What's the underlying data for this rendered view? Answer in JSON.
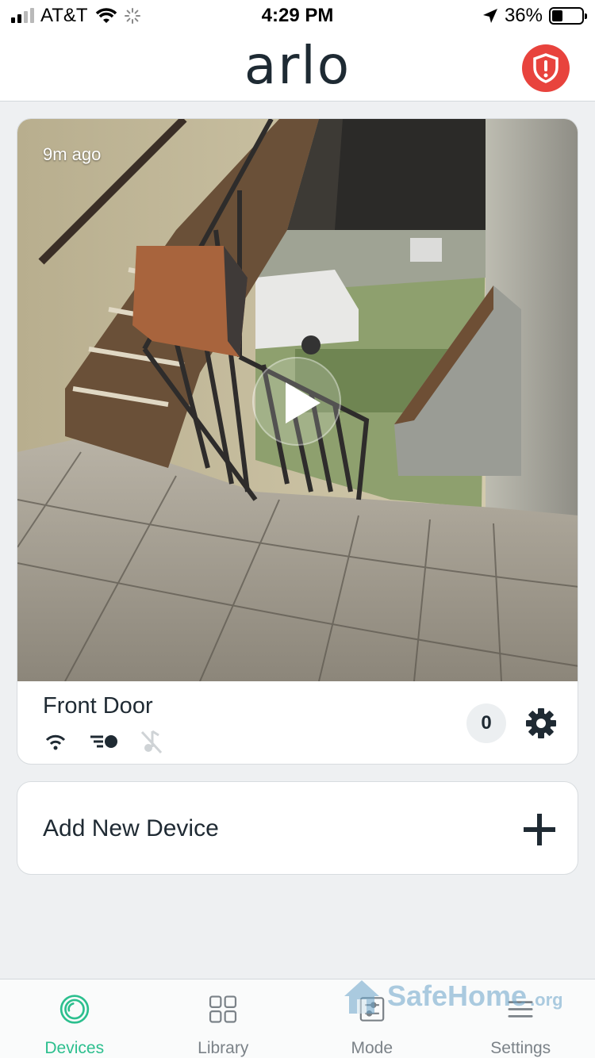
{
  "status_bar": {
    "carrier": "AT&T",
    "time": "4:29 PM",
    "battery": "36%",
    "battery_level": 0.36,
    "icons": [
      "signal-icon",
      "wifi-icon",
      "loading-icon",
      "location-icon",
      "battery-icon"
    ]
  },
  "header": {
    "logo": "arlo",
    "alert_icon": "shield-alert-icon",
    "alert_color": "#e8433d"
  },
  "camera": {
    "time_ago": "9m ago",
    "name": "Front Door",
    "event_count": "0",
    "status_icons": [
      "wifi-icon",
      "motion-icon",
      "audio-off-icon"
    ],
    "settings_icon": "gear-icon",
    "play_icon": "play-icon"
  },
  "add_device": {
    "label": "Add New Device",
    "icon": "plus-icon"
  },
  "tabs": [
    {
      "label": "Devices",
      "icon": "devices-icon",
      "active": true
    },
    {
      "label": "Library",
      "icon": "library-grid-icon",
      "active": false
    },
    {
      "label": "Mode",
      "icon": "mode-icon",
      "active": false
    },
    {
      "label": "Settings",
      "icon": "menu-icon",
      "active": false
    }
  ],
  "watermark": {
    "text": "SafeHome",
    "suffix": ".org"
  },
  "colors": {
    "accent": "#2cbf8e",
    "text": "#1f2a33",
    "background": "#eef0f2"
  }
}
